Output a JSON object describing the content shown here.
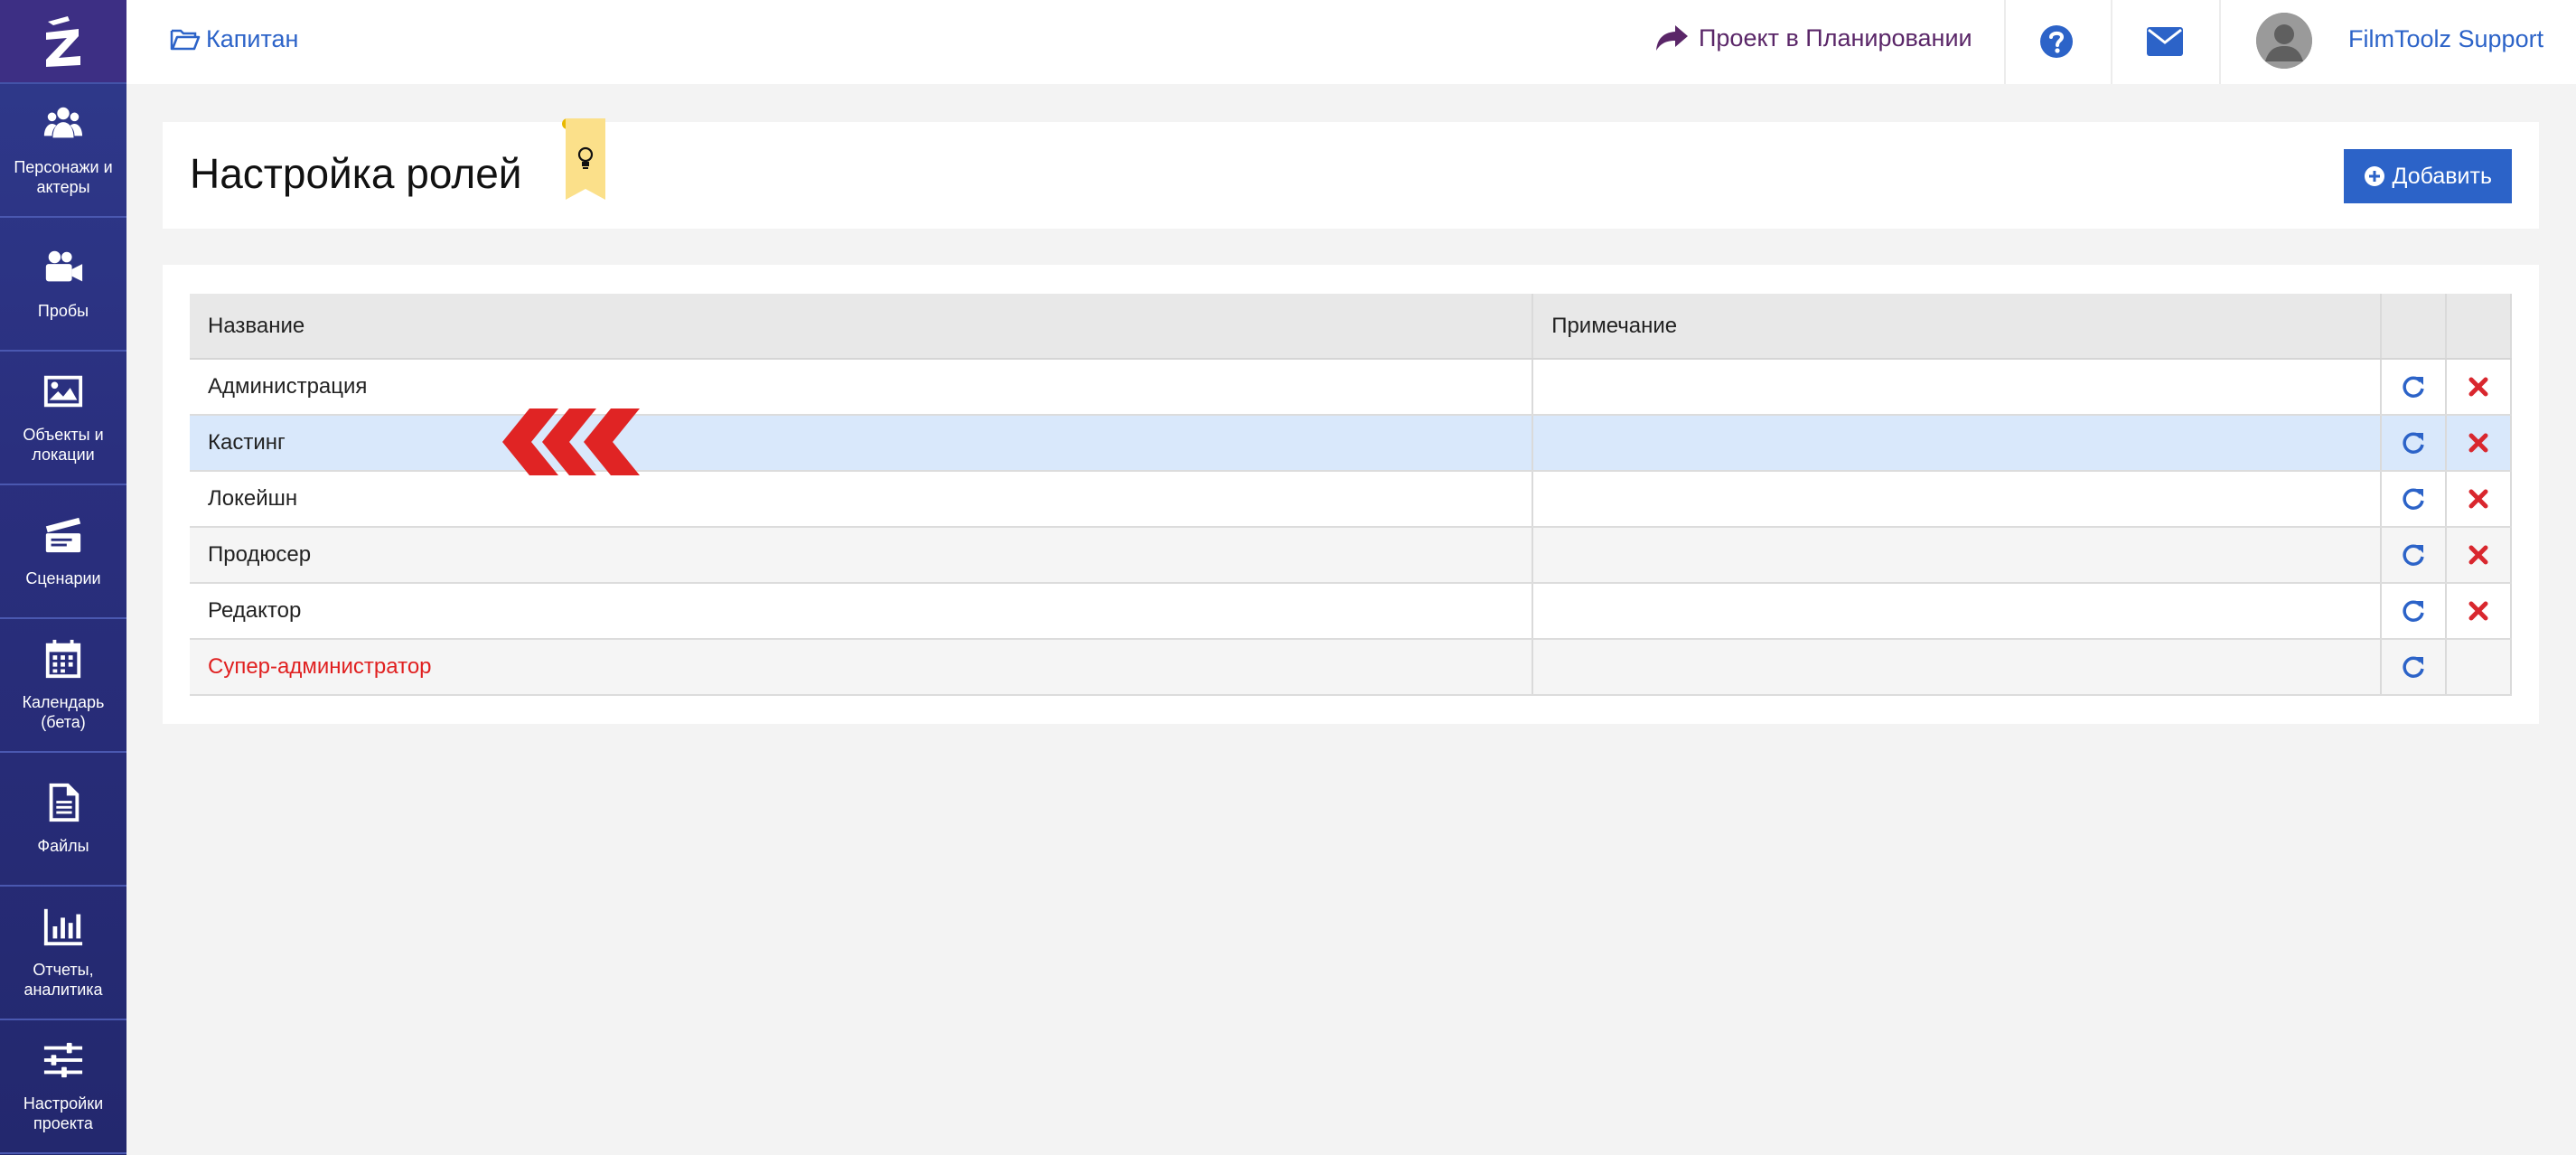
{
  "sidebar": {
    "items": [
      {
        "label": "Персонажи и актеры",
        "icon": "people-icon"
      },
      {
        "label": "Пробы",
        "icon": "video-camera-icon"
      },
      {
        "label": "Объекты и локации",
        "icon": "image-icon"
      },
      {
        "label": "Сценарии",
        "icon": "clapperboard-icon"
      },
      {
        "label": "Календарь (бета)",
        "icon": "calendar-icon"
      },
      {
        "label": "Файлы",
        "icon": "file-icon"
      },
      {
        "label": "Отчеты, аналитика",
        "icon": "bar-chart-icon"
      },
      {
        "label": "Настройки проекта",
        "icon": "sliders-icon"
      }
    ]
  },
  "topbar": {
    "breadcrumb": "Капитан",
    "project_status": "Проект в Планировании",
    "username": "FilmToolz Support"
  },
  "page": {
    "title": "Настройка ролей",
    "add_button": "Добавить"
  },
  "table": {
    "headers": {
      "name": "Название",
      "note": "Примечание"
    },
    "rows": [
      {
        "name": "Администрация",
        "note": ""
      },
      {
        "name": "Кастинг",
        "note": ""
      },
      {
        "name": "Локейшн",
        "note": ""
      },
      {
        "name": "Продюсер",
        "note": ""
      },
      {
        "name": "Редактор",
        "note": ""
      },
      {
        "name": "Супер-администратор",
        "note": ""
      }
    ]
  },
  "colors": {
    "accent": "#2c63c8",
    "sidebar": "#2a2f7e",
    "project_link": "#5a2668",
    "delete": "#d9272e",
    "super_admin": "#e01f1f",
    "highlight_row": "#d9e8fb"
  }
}
